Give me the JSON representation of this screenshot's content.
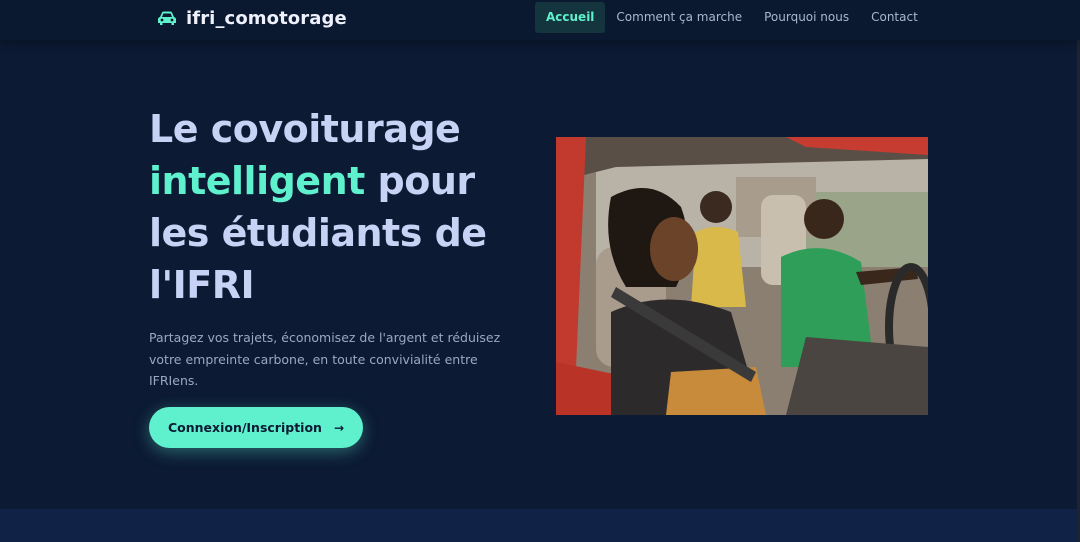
{
  "brand": {
    "name": "ifri_comotorage",
    "icon": "car-icon"
  },
  "nav": {
    "items": [
      {
        "label": "Accueil",
        "active": true
      },
      {
        "label": "Comment ça marche",
        "active": false
      },
      {
        "label": "Pourquoi nous",
        "active": false
      },
      {
        "label": "Contact",
        "active": false
      }
    ]
  },
  "hero": {
    "title_line1": "Le covoiturage",
    "title_accent": "intelligent",
    "title_line2_rest": " pour",
    "title_line3": "les étudiants de",
    "title_line4": "l'IFRI",
    "description": "Partagez vos trajets, économisez de l'argent et réduisez votre empreinte carbone, en toute convivialité entre IFRIens.",
    "cta_label": "Connexion/Inscription",
    "cta_icon": "arrow-right-icon"
  },
  "colors": {
    "background": "#0c1a33",
    "accent": "#5ff0cd",
    "title": "#c7d2f4",
    "nav_active_bg": "#14353d"
  }
}
